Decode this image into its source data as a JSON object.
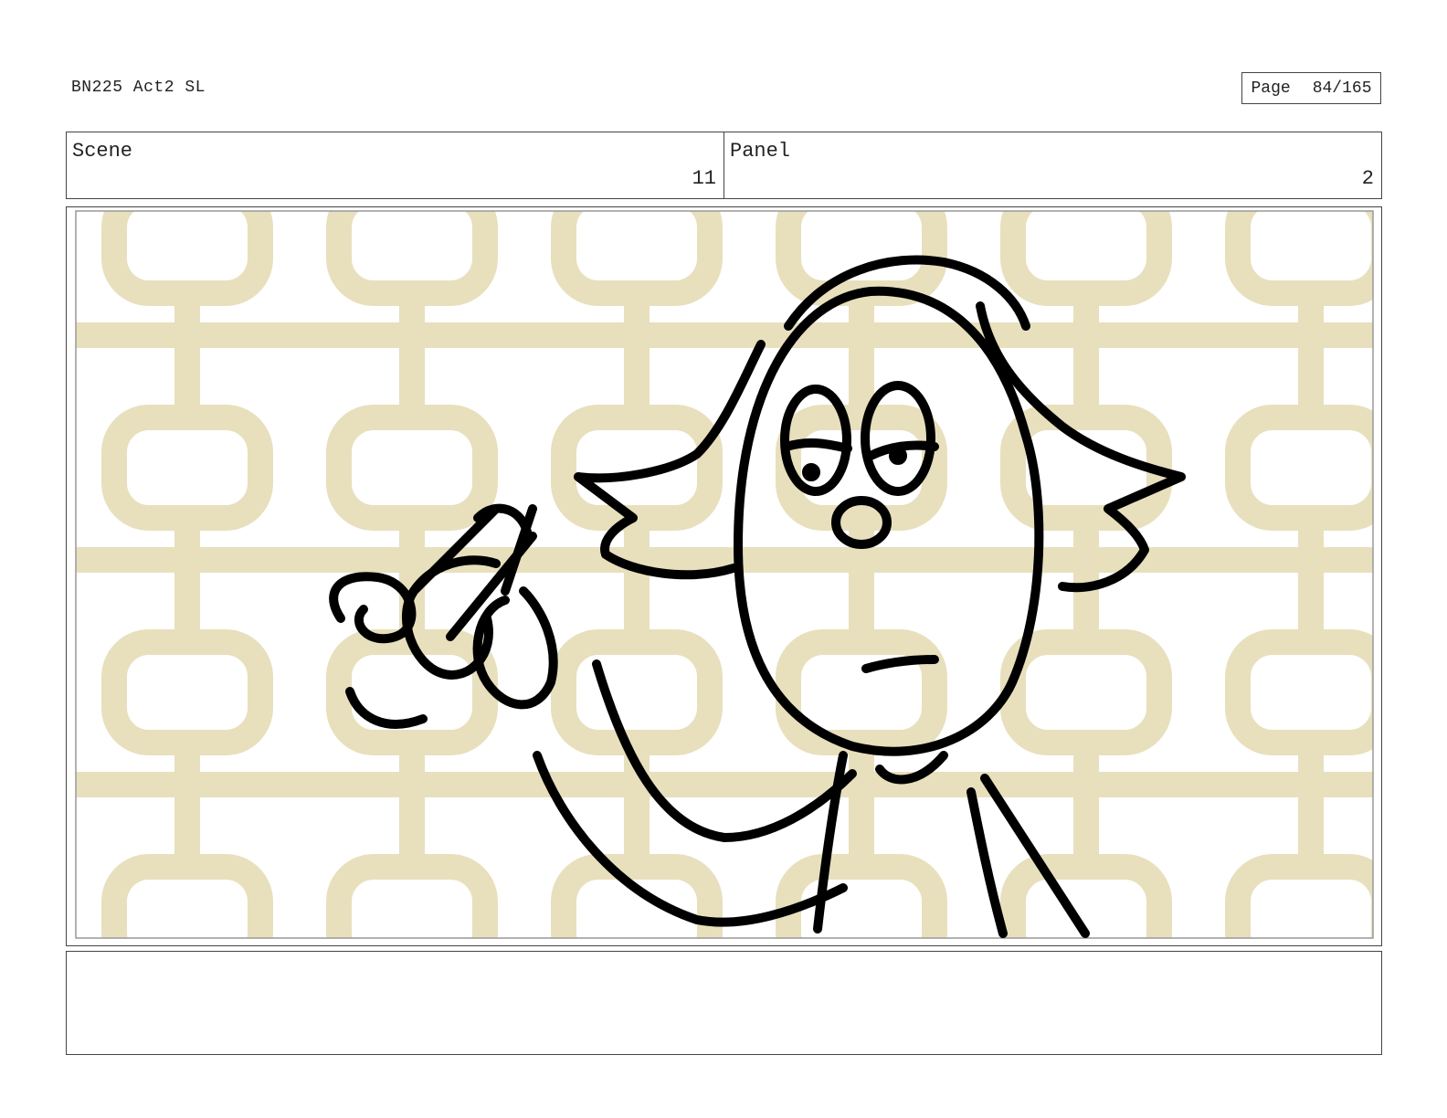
{
  "header": {
    "document_title": "BN225 Act2 SL",
    "page_label": "Page",
    "page_value": "84/165"
  },
  "info_bar": {
    "scene_label": "Scene",
    "scene_value": "11",
    "panel_label": "Panel",
    "panel_value": "2"
  },
  "panel_image": {
    "background_color": "#e8dfbd",
    "line_color": "#000000"
  },
  "notes": {
    "text": ""
  }
}
